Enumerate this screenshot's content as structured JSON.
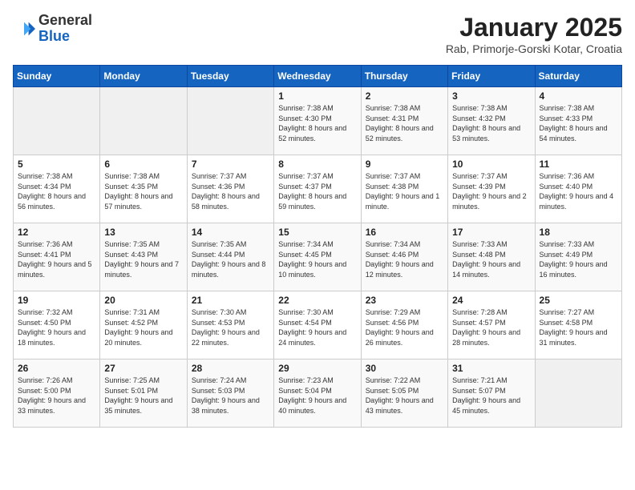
{
  "header": {
    "logo_general": "General",
    "logo_blue": "Blue",
    "month_title": "January 2025",
    "location": "Rab, Primorje-Gorski Kotar, Croatia"
  },
  "days_of_week": [
    "Sunday",
    "Monday",
    "Tuesday",
    "Wednesday",
    "Thursday",
    "Friday",
    "Saturday"
  ],
  "weeks": [
    {
      "cells": [
        {
          "day": "",
          "empty": true
        },
        {
          "day": "",
          "empty": true
        },
        {
          "day": "",
          "empty": true
        },
        {
          "day": "1",
          "sunrise": "7:38 AM",
          "sunset": "4:30 PM",
          "daylight": "8 hours and 52 minutes."
        },
        {
          "day": "2",
          "sunrise": "7:38 AM",
          "sunset": "4:31 PM",
          "daylight": "8 hours and 52 minutes."
        },
        {
          "day": "3",
          "sunrise": "7:38 AM",
          "sunset": "4:32 PM",
          "daylight": "8 hours and 53 minutes."
        },
        {
          "day": "4",
          "sunrise": "7:38 AM",
          "sunset": "4:33 PM",
          "daylight": "8 hours and 54 minutes."
        }
      ]
    },
    {
      "cells": [
        {
          "day": "5",
          "sunrise": "7:38 AM",
          "sunset": "4:34 PM",
          "daylight": "8 hours and 56 minutes."
        },
        {
          "day": "6",
          "sunrise": "7:38 AM",
          "sunset": "4:35 PM",
          "daylight": "8 hours and 57 minutes."
        },
        {
          "day": "7",
          "sunrise": "7:37 AM",
          "sunset": "4:36 PM",
          "daylight": "8 hours and 58 minutes."
        },
        {
          "day": "8",
          "sunrise": "7:37 AM",
          "sunset": "4:37 PM",
          "daylight": "8 hours and 59 minutes."
        },
        {
          "day": "9",
          "sunrise": "7:37 AM",
          "sunset": "4:38 PM",
          "daylight": "9 hours and 1 minute."
        },
        {
          "day": "10",
          "sunrise": "7:37 AM",
          "sunset": "4:39 PM",
          "daylight": "9 hours and 2 minutes."
        },
        {
          "day": "11",
          "sunrise": "7:36 AM",
          "sunset": "4:40 PM",
          "daylight": "9 hours and 4 minutes."
        }
      ]
    },
    {
      "cells": [
        {
          "day": "12",
          "sunrise": "7:36 AM",
          "sunset": "4:41 PM",
          "daylight": "9 hours and 5 minutes."
        },
        {
          "day": "13",
          "sunrise": "7:35 AM",
          "sunset": "4:43 PM",
          "daylight": "9 hours and 7 minutes."
        },
        {
          "day": "14",
          "sunrise": "7:35 AM",
          "sunset": "4:44 PM",
          "daylight": "9 hours and 8 minutes."
        },
        {
          "day": "15",
          "sunrise": "7:34 AM",
          "sunset": "4:45 PM",
          "daylight": "9 hours and 10 minutes."
        },
        {
          "day": "16",
          "sunrise": "7:34 AM",
          "sunset": "4:46 PM",
          "daylight": "9 hours and 12 minutes."
        },
        {
          "day": "17",
          "sunrise": "7:33 AM",
          "sunset": "4:48 PM",
          "daylight": "9 hours and 14 minutes."
        },
        {
          "day": "18",
          "sunrise": "7:33 AM",
          "sunset": "4:49 PM",
          "daylight": "9 hours and 16 minutes."
        }
      ]
    },
    {
      "cells": [
        {
          "day": "19",
          "sunrise": "7:32 AM",
          "sunset": "4:50 PM",
          "daylight": "9 hours and 18 minutes."
        },
        {
          "day": "20",
          "sunrise": "7:31 AM",
          "sunset": "4:52 PM",
          "daylight": "9 hours and 20 minutes."
        },
        {
          "day": "21",
          "sunrise": "7:30 AM",
          "sunset": "4:53 PM",
          "daylight": "9 hours and 22 minutes."
        },
        {
          "day": "22",
          "sunrise": "7:30 AM",
          "sunset": "4:54 PM",
          "daylight": "9 hours and 24 minutes."
        },
        {
          "day": "23",
          "sunrise": "7:29 AM",
          "sunset": "4:56 PM",
          "daylight": "9 hours and 26 minutes."
        },
        {
          "day": "24",
          "sunrise": "7:28 AM",
          "sunset": "4:57 PM",
          "daylight": "9 hours and 28 minutes."
        },
        {
          "day": "25",
          "sunrise": "7:27 AM",
          "sunset": "4:58 PM",
          "daylight": "9 hours and 31 minutes."
        }
      ]
    },
    {
      "cells": [
        {
          "day": "26",
          "sunrise": "7:26 AM",
          "sunset": "5:00 PM",
          "daylight": "9 hours and 33 minutes."
        },
        {
          "day": "27",
          "sunrise": "7:25 AM",
          "sunset": "5:01 PM",
          "daylight": "9 hours and 35 minutes."
        },
        {
          "day": "28",
          "sunrise": "7:24 AM",
          "sunset": "5:03 PM",
          "daylight": "9 hours and 38 minutes."
        },
        {
          "day": "29",
          "sunrise": "7:23 AM",
          "sunset": "5:04 PM",
          "daylight": "9 hours and 40 minutes."
        },
        {
          "day": "30",
          "sunrise": "7:22 AM",
          "sunset": "5:05 PM",
          "daylight": "9 hours and 43 minutes."
        },
        {
          "day": "31",
          "sunrise": "7:21 AM",
          "sunset": "5:07 PM",
          "daylight": "9 hours and 45 minutes."
        },
        {
          "day": "",
          "empty": true
        }
      ]
    }
  ]
}
